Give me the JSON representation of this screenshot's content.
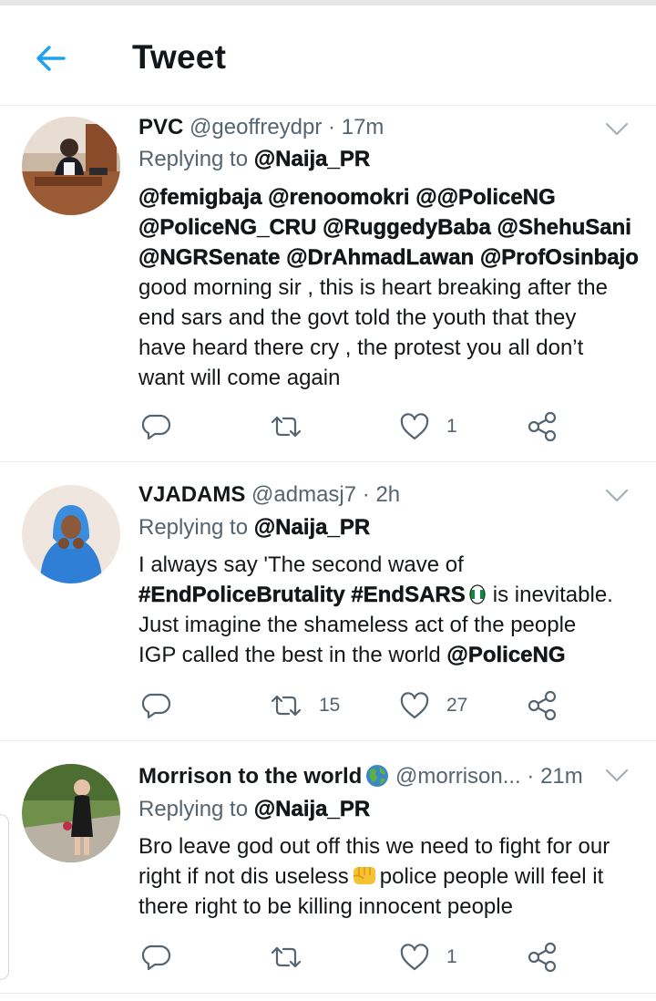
{
  "header": {
    "title": "Tweet",
    "back_icon": "arrow-left-icon",
    "accent": "#1da1f2"
  },
  "tweets": [
    {
      "name": "PVC",
      "handle": "@geoffreydpr",
      "sep": "·",
      "time": "17m",
      "replying_prefix": "Replying to",
      "replying_to": "@Naija_PR",
      "mentions_line1": "@femigbaja @renoomokri @@PoliceNG",
      "mentions_line2": "@PoliceNG_CRU @RuggedyBaba @ShehuSani",
      "mentions_line3": "@NGRSenate @DrAhmadLawan @ProfOsinbajo",
      "text_line1": "good morning sir , this is heart breaking after the",
      "text_line2": "end sars and the govt told the youth that they",
      "text_line3": "have heard there cry , the protest you all don’t",
      "text_line4": "want will come again",
      "reply_count": "",
      "retweet_count": "",
      "like_count": "1"
    },
    {
      "name": "VJADAMS",
      "handle": "@admasj7",
      "sep": "·",
      "time": "2h",
      "replying_prefix": "Replying to",
      "replying_to": "@Naija_PR",
      "text_line1": "I always say 'The second wave of",
      "hashtag1": "#EndPoliceBrutality",
      "hashtag2": "#EndSARS",
      "text_line2_end": "is inevitable.",
      "text_line3": "Just imagine the shameless act of the people",
      "text_line4_start": "IGP called the best in the world",
      "text_line4_mention": "@PoliceNG",
      "reply_count": "",
      "retweet_count": "15",
      "like_count": "27"
    },
    {
      "name": "Morrison to the world",
      "handle": "@morrison...",
      "sep": "·",
      "time": "21m",
      "replying_prefix": "Replying to",
      "replying_to": "@Naija_PR",
      "text_line1": "Bro leave god out off this we need to fight for our",
      "text_line2_start": "right if not dis useless",
      "text_line2_end": "police people will feel it",
      "text_line3": "there right to be killing innocent people",
      "reply_count": "",
      "retweet_count": "",
      "like_count": "1"
    }
  ],
  "icons": {
    "reply": "reply-bubble-icon",
    "retweet": "retweet-icon",
    "like": "heart-icon",
    "share": "share-icon",
    "more": "chevron-down-icon",
    "globe": "globe-emoji",
    "fist": "fist-emoji",
    "flag": "nigeria-flag-emoji"
  },
  "colors": {
    "icon_gray": "#546470",
    "divider": "#e6ecf0",
    "text": "#14171a"
  }
}
